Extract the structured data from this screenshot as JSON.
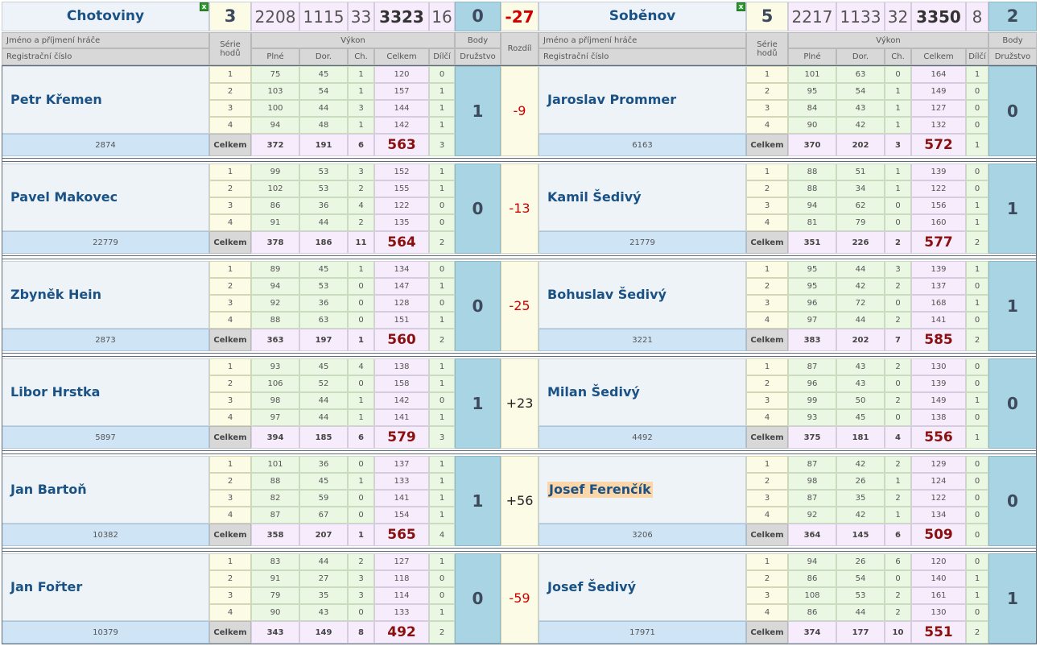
{
  "home": {
    "team": "Chotoviny",
    "score": "3",
    "plne": "2208",
    "dor": "1115",
    "ch": "33",
    "total": "3323",
    "dilci": "16",
    "body": "0",
    "close_glyph": "x"
  },
  "away": {
    "team": "Soběnov",
    "score": "5",
    "plne": "2217",
    "dor": "1133",
    "ch": "32",
    "total": "3350",
    "dilci": "8",
    "body": "2",
    "close_glyph": "x"
  },
  "rozdil_total": "-27",
  "headers": {
    "name": "Jméno a příjmení hráče",
    "reg": "Registrační číslo",
    "serie_line1": "Série",
    "serie_line2": "hodů",
    "vykon": "Výkon",
    "plne": "Plné",
    "dor": "Dor.",
    "ch": "Ch.",
    "celkem": "Celkem",
    "dilci": "Dílčí",
    "body": "Body",
    "druzstvo": "Družstvo",
    "rozdil": "Rozdíl"
  },
  "total_label": "Celkem",
  "matches": [
    {
      "home": {
        "name": "Petr Křemen",
        "reg": "2874",
        "rows": [
          [
            "1",
            "75",
            "45",
            "1",
            "120",
            "0"
          ],
          [
            "2",
            "103",
            "54",
            "1",
            "157",
            "1"
          ],
          [
            "3",
            "100",
            "44",
            "3",
            "144",
            "1"
          ],
          [
            "4",
            "94",
            "48",
            "1",
            "142",
            "1"
          ]
        ],
        "tot": {
          "plne": "372",
          "dor": "191",
          "ch": "6",
          "celkem": "563",
          "dilci": "3"
        },
        "body": "1"
      },
      "away": {
        "name": "Jaroslav Prommer",
        "reg": "6163",
        "rows": [
          [
            "1",
            "101",
            "63",
            "0",
            "164",
            "1"
          ],
          [
            "2",
            "95",
            "54",
            "1",
            "149",
            "0"
          ],
          [
            "3",
            "84",
            "43",
            "1",
            "127",
            "0"
          ],
          [
            "4",
            "90",
            "42",
            "1",
            "132",
            "0"
          ]
        ],
        "tot": {
          "plne": "370",
          "dor": "202",
          "ch": "3",
          "celkem": "572",
          "dilci": "1"
        },
        "body": "0"
      },
      "diff": "-9"
    },
    {
      "home": {
        "name": "Pavel Makovec",
        "reg": "22779",
        "rows": [
          [
            "1",
            "99",
            "53",
            "3",
            "152",
            "1"
          ],
          [
            "2",
            "102",
            "53",
            "2",
            "155",
            "1"
          ],
          [
            "3",
            "86",
            "36",
            "4",
            "122",
            "0"
          ],
          [
            "4",
            "91",
            "44",
            "2",
            "135",
            "0"
          ]
        ],
        "tot": {
          "plne": "378",
          "dor": "186",
          "ch": "11",
          "celkem": "564",
          "dilci": "2"
        },
        "body": "0"
      },
      "away": {
        "name": "Kamil Šedivý",
        "reg": "21779",
        "rows": [
          [
            "1",
            "88",
            "51",
            "1",
            "139",
            "0"
          ],
          [
            "2",
            "88",
            "34",
            "1",
            "122",
            "0"
          ],
          [
            "3",
            "94",
            "62",
            "0",
            "156",
            "1"
          ],
          [
            "4",
            "81",
            "79",
            "0",
            "160",
            "1"
          ]
        ],
        "tot": {
          "plne": "351",
          "dor": "226",
          "ch": "2",
          "celkem": "577",
          "dilci": "2"
        },
        "body": "1"
      },
      "diff": "-13"
    },
    {
      "home": {
        "name": "Zbyněk Hein",
        "reg": "2873",
        "rows": [
          [
            "1",
            "89",
            "45",
            "1",
            "134",
            "0"
          ],
          [
            "2",
            "94",
            "53",
            "0",
            "147",
            "1"
          ],
          [
            "3",
            "92",
            "36",
            "0",
            "128",
            "0"
          ],
          [
            "4",
            "88",
            "63",
            "0",
            "151",
            "1"
          ]
        ],
        "tot": {
          "plne": "363",
          "dor": "197",
          "ch": "1",
          "celkem": "560",
          "dilci": "2"
        },
        "body": "0"
      },
      "away": {
        "name": "Bohuslav Šedivý",
        "reg": "3221",
        "rows": [
          [
            "1",
            "95",
            "44",
            "3",
            "139",
            "1"
          ],
          [
            "2",
            "95",
            "42",
            "2",
            "137",
            "0"
          ],
          [
            "3",
            "96",
            "72",
            "0",
            "168",
            "1"
          ],
          [
            "4",
            "97",
            "44",
            "2",
            "141",
            "0"
          ]
        ],
        "tot": {
          "plne": "383",
          "dor": "202",
          "ch": "7",
          "celkem": "585",
          "dilci": "2"
        },
        "body": "1"
      },
      "diff": "-25"
    },
    {
      "home": {
        "name": "Libor Hrstka",
        "reg": "5897",
        "rows": [
          [
            "1",
            "93",
            "45",
            "4",
            "138",
            "1"
          ],
          [
            "2",
            "106",
            "52",
            "0",
            "158",
            "1"
          ],
          [
            "3",
            "98",
            "44",
            "1",
            "142",
            "0"
          ],
          [
            "4",
            "97",
            "44",
            "1",
            "141",
            "1"
          ]
        ],
        "tot": {
          "plne": "394",
          "dor": "185",
          "ch": "6",
          "celkem": "579",
          "dilci": "3"
        },
        "body": "1"
      },
      "away": {
        "name": "Milan Šedivý",
        "reg": "4492",
        "rows": [
          [
            "1",
            "87",
            "43",
            "2",
            "130",
            "0"
          ],
          [
            "2",
            "96",
            "43",
            "0",
            "139",
            "0"
          ],
          [
            "3",
            "99",
            "50",
            "2",
            "149",
            "1"
          ],
          [
            "4",
            "93",
            "45",
            "0",
            "138",
            "0"
          ]
        ],
        "tot": {
          "plne": "375",
          "dor": "181",
          "ch": "4",
          "celkem": "556",
          "dilci": "1"
        },
        "body": "0"
      },
      "diff": "+23"
    },
    {
      "home": {
        "name": "Jan Bartoň",
        "reg": "10382",
        "rows": [
          [
            "1",
            "101",
            "36",
            "0",
            "137",
            "1"
          ],
          [
            "2",
            "88",
            "45",
            "1",
            "133",
            "1"
          ],
          [
            "3",
            "82",
            "59",
            "0",
            "141",
            "1"
          ],
          [
            "4",
            "87",
            "67",
            "0",
            "154",
            "1"
          ]
        ],
        "tot": {
          "plne": "358",
          "dor": "207",
          "ch": "1",
          "celkem": "565",
          "dilci": "4"
        },
        "body": "1"
      },
      "away": {
        "name": "Josef Ferenčík",
        "reg": "3206",
        "highlight": true,
        "rows": [
          [
            "1",
            "87",
            "42",
            "2",
            "129",
            "0"
          ],
          [
            "2",
            "98",
            "26",
            "1",
            "124",
            "0"
          ],
          [
            "3",
            "87",
            "35",
            "2",
            "122",
            "0"
          ],
          [
            "4",
            "92",
            "42",
            "1",
            "134",
            "0"
          ]
        ],
        "tot": {
          "plne": "364",
          "dor": "145",
          "ch": "6",
          "celkem": "509",
          "dilci": "0"
        },
        "body": "0"
      },
      "diff": "+56"
    },
    {
      "home": {
        "name": "Jan Fořter",
        "reg": "10379",
        "rows": [
          [
            "1",
            "83",
            "44",
            "2",
            "127",
            "1"
          ],
          [
            "2",
            "91",
            "27",
            "3",
            "118",
            "0"
          ],
          [
            "3",
            "79",
            "35",
            "3",
            "114",
            "0"
          ],
          [
            "4",
            "90",
            "43",
            "0",
            "133",
            "1"
          ]
        ],
        "tot": {
          "plne": "343",
          "dor": "149",
          "ch": "8",
          "celkem": "492",
          "dilci": "2"
        },
        "body": "0"
      },
      "away": {
        "name": "Josef Šedivý",
        "reg": "17971",
        "rows": [
          [
            "1",
            "94",
            "26",
            "6",
            "120",
            "0"
          ],
          [
            "2",
            "86",
            "54",
            "0",
            "140",
            "1"
          ],
          [
            "3",
            "108",
            "53",
            "2",
            "161",
            "1"
          ],
          [
            "4",
            "86",
            "44",
            "2",
            "130",
            "0"
          ]
        ],
        "tot": {
          "plne": "374",
          "dor": "177",
          "ch": "10",
          "celkem": "551",
          "dilci": "2"
        },
        "body": "1"
      },
      "diff": "-59"
    }
  ]
}
